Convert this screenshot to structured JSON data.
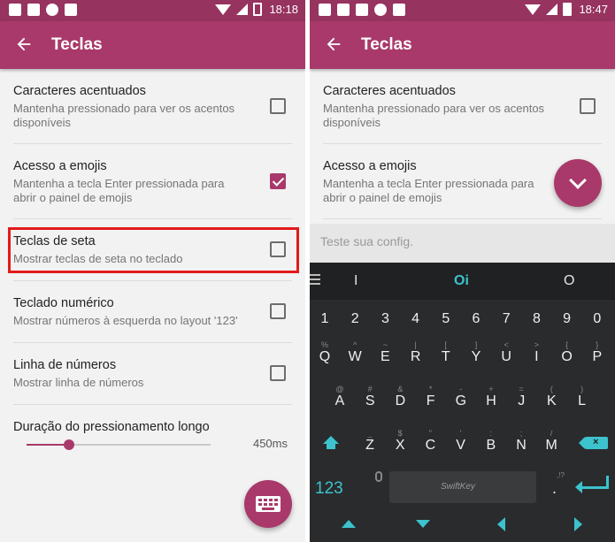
{
  "left": {
    "status": {
      "time": "18:18"
    },
    "appbar": {
      "title": "Teclas"
    },
    "items": [
      {
        "title": "Caracteres acentuados",
        "subtitle": "Mantenha pressionado para ver os acentos disponíveis",
        "checked": false
      },
      {
        "title": "Acesso a emojis",
        "subtitle": "Mantenha a tecla Enter pressionada para abrir o painel de emojis",
        "checked": true
      },
      {
        "title": "Teclas de seta",
        "subtitle": "Mostrar teclas de seta no teclado",
        "checked": false,
        "highlighted": true
      },
      {
        "title": "Teclado numérico",
        "subtitle": "Mostrar números à esquerda no layout '123'",
        "checked": false
      },
      {
        "title": "Linha de números",
        "subtitle": "Mostrar linha de números",
        "checked": false
      }
    ],
    "slider": {
      "title": "Duração do pressionamento longo",
      "value": "450ms",
      "fraction": 0.23
    },
    "fab_icon": "keyboard-icon"
  },
  "right": {
    "status": {
      "time": "18:47"
    },
    "appbar": {
      "title": "Teclas"
    },
    "items": [
      {
        "title": "Caracteres acentuados",
        "subtitle": "Mantenha pressionado para ver os acentos disponíveis",
        "checked": false
      },
      {
        "title": "Acesso a emojis",
        "subtitle": "Mantenha a tecla Enter pressionada para abrir o painel de emojis"
      }
    ],
    "fab_icon": "chevron-down-icon",
    "test_field": {
      "placeholder": "Teste sua config."
    },
    "keyboard": {
      "predictions": [
        "I",
        "Oi",
        "O"
      ],
      "number_row": [
        "1",
        "2",
        "3",
        "4",
        "5",
        "6",
        "7",
        "8",
        "9",
        "0"
      ],
      "row1": [
        "Q",
        "W",
        "E",
        "R",
        "T",
        "Y",
        "U",
        "I",
        "O",
        "P"
      ],
      "row1_alt": [
        "%",
        "^",
        "~",
        "|",
        "[",
        "]",
        "<",
        ">",
        "{",
        "}"
      ],
      "row2": [
        "A",
        "S",
        "D",
        "F",
        "G",
        "H",
        "J",
        "K",
        "L"
      ],
      "row2_alt": [
        "@",
        "#",
        "&",
        "*",
        "-",
        "+",
        "=",
        "(",
        ")"
      ],
      "row3": [
        "Z",
        "X",
        "C",
        "V",
        "B",
        "N",
        "M"
      ],
      "row3_alt": [
        "_",
        "$",
        "\"",
        "'",
        ":",
        ";",
        "/"
      ],
      "mode_key": "123",
      "space_label": "SwiftKey",
      "punct_key": ".",
      "punct_alt": ",!?"
    }
  },
  "colors": {
    "primary": "#a8396a",
    "status_bar": "#96335f",
    "accent": "#3cc3cd",
    "highlight": "#e31a1a"
  }
}
